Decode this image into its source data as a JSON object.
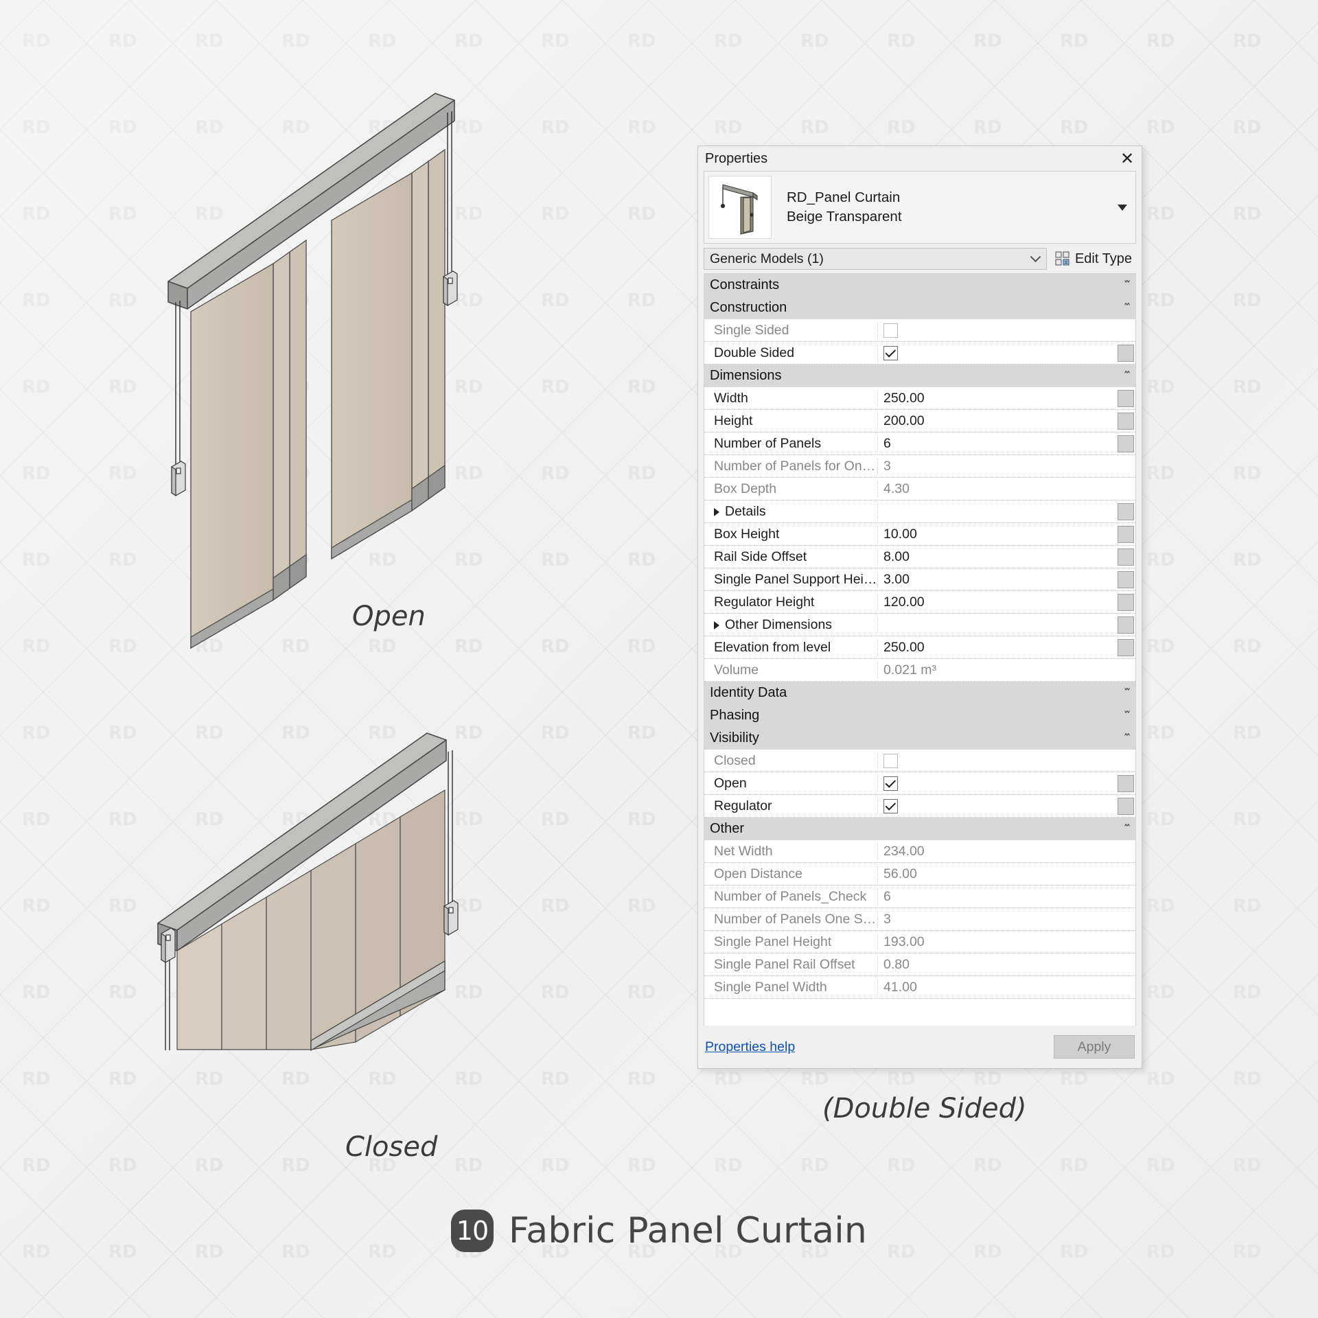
{
  "caption": {
    "badge": "10",
    "title": "Fabric Panel Curtain"
  },
  "views": {
    "open_label": "Open",
    "closed_label": "Closed",
    "double_sided_note": "(Double Sided)"
  },
  "palette": {
    "title": "Properties",
    "close_icon": "close-icon",
    "type": {
      "family": "RD_Panel Curtain",
      "name": "Beige Transparent",
      "dropdown_icon": "chevron-down-icon"
    },
    "category": {
      "value": "Generic Models (1)",
      "chevron_icon": "chevron-down-icon"
    },
    "edit_type": {
      "label": "Edit Type",
      "icon": "edit-type-icon"
    },
    "footer": {
      "help_link": "Properties help",
      "apply_label": "Apply"
    },
    "rows": [
      {
        "kind": "section",
        "label": "Constraints",
        "toggle": "»"
      },
      {
        "kind": "section",
        "label": "Construction",
        "toggle": "«"
      },
      {
        "kind": "prop",
        "label": "Single Sided",
        "type": "checkbox",
        "checked": false,
        "readonly": true,
        "stepper": false
      },
      {
        "kind": "prop",
        "label": "Double Sided",
        "type": "checkbox",
        "checked": true,
        "readonly": false,
        "stepper": true
      },
      {
        "kind": "section",
        "label": "Dimensions",
        "toggle": "«"
      },
      {
        "kind": "prop",
        "label": "Width",
        "value": "250.00",
        "readonly": false,
        "stepper": true
      },
      {
        "kind": "prop",
        "label": "Height",
        "value": "200.00",
        "readonly": false,
        "stepper": true
      },
      {
        "kind": "prop",
        "label": "Number of Panels",
        "value": "6",
        "readonly": false,
        "stepper": true
      },
      {
        "kind": "prop",
        "label": "Number of Panels for One Side",
        "value": "3",
        "readonly": true,
        "stepper": false
      },
      {
        "kind": "prop",
        "label": "Box Depth",
        "value": "4.30",
        "readonly": true,
        "stepper": false
      },
      {
        "kind": "expander",
        "label": "Details",
        "value": "",
        "readonly": false,
        "stepper": true
      },
      {
        "kind": "prop",
        "label": "Box Height",
        "value": "10.00",
        "readonly": false,
        "stepper": true
      },
      {
        "kind": "prop",
        "label": "Rail Side Offset",
        "value": "8.00",
        "readonly": false,
        "stepper": true
      },
      {
        "kind": "prop",
        "label": "Single Panel Support Height",
        "value": "3.00",
        "readonly": false,
        "stepper": true
      },
      {
        "kind": "prop",
        "label": "Regulator Height",
        "value": "120.00",
        "readonly": false,
        "stepper": true
      },
      {
        "kind": "expander",
        "label": "Other Dimensions",
        "value": "",
        "readonly": false,
        "stepper": true
      },
      {
        "kind": "prop",
        "label": "Elevation from level",
        "value": "250.00",
        "readonly": false,
        "stepper": true
      },
      {
        "kind": "prop",
        "label": "Volume",
        "value": "0.021 m³",
        "readonly": true,
        "stepper": false
      },
      {
        "kind": "section",
        "label": "Identity Data",
        "toggle": "»"
      },
      {
        "kind": "section",
        "label": "Phasing",
        "toggle": "»"
      },
      {
        "kind": "section",
        "label": "Visibility",
        "toggle": "«"
      },
      {
        "kind": "prop",
        "label": "Closed",
        "type": "checkbox",
        "checked": false,
        "readonly": true,
        "stepper": false
      },
      {
        "kind": "prop",
        "label": "Open",
        "type": "checkbox",
        "checked": true,
        "readonly": false,
        "stepper": true
      },
      {
        "kind": "prop",
        "label": "Regulator",
        "type": "checkbox",
        "checked": true,
        "readonly": false,
        "stepper": true
      },
      {
        "kind": "section",
        "label": "Other",
        "toggle": "«"
      },
      {
        "kind": "prop",
        "label": "Net Width",
        "value": "234.00",
        "readonly": true,
        "stepper": false
      },
      {
        "kind": "prop",
        "label": "Open Distance",
        "value": "56.00",
        "readonly": true,
        "stepper": false
      },
      {
        "kind": "prop",
        "label": "Number of Panels_Check",
        "value": "6",
        "readonly": true,
        "stepper": false
      },
      {
        "kind": "prop",
        "label": "Number of Panels One Side_C...",
        "value": "3",
        "readonly": true,
        "stepper": false
      },
      {
        "kind": "prop",
        "label": "Single Panel Height",
        "value": "193.00",
        "readonly": true,
        "stepper": false
      },
      {
        "kind": "prop",
        "label": "Single Panel Rail Offset",
        "value": "0.80",
        "readonly": true,
        "stepper": false
      },
      {
        "kind": "prop",
        "label": "Single Panel Width",
        "value": "41.00",
        "readonly": true,
        "stepper": false
      }
    ]
  },
  "watermark": {
    "text": "RD"
  },
  "colors": {
    "background": "#f0f0f0",
    "fabric": "#cdc3b4",
    "fabric_light": "#d7cec1",
    "rail": "#b0b0ae",
    "rail_dark": "#8f8f8d",
    "link": "#0b51b7",
    "section_header": "#d8d8d8",
    "badge": "#4a4a4a"
  }
}
